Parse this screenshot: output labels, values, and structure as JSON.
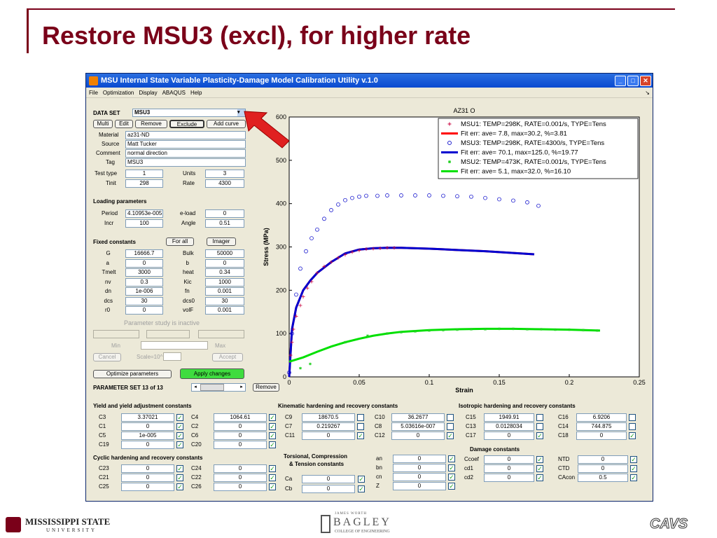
{
  "slide": {
    "title": "Restore MSU3 (excl), for higher rate",
    "logo_left": "MISSISSIPPI STATE",
    "logo_left_sub": "UNIVERSITY",
    "logo_center": "BAGLEY",
    "logo_center_top": "JAMES WORTH",
    "logo_center_sub": "COLLEGE OF ENGINEERING",
    "logo_right": "CAVS"
  },
  "window": {
    "title": "MSU Internal State Variable Plasticity-Damage Model Calibration Utility v.1.0",
    "menus": [
      "File",
      "Optimization",
      "Display",
      "ABAQUS",
      "Help"
    ],
    "menu_end": "↘"
  },
  "dataset": {
    "label": "DATA SET",
    "value": "MSU3",
    "buttons": [
      "Multi",
      "Edit",
      "Remove",
      "Exclude",
      "Add curve"
    ],
    "material_label": "Material",
    "material": "az31-ND",
    "source_label": "Source",
    "source": "Matt Tucker",
    "comment_label": "Comment",
    "comment": "normal direction",
    "tag_label": "Tag",
    "tag": "MSU3",
    "testtype_label": "Test type",
    "testtype": "1",
    "units_label": "Units",
    "units": "3",
    "tinit_label": "Tinit",
    "tinit": "298",
    "rate_label": "Rate",
    "rate": "4300"
  },
  "loading": {
    "heading": "Loading parameters",
    "period_label": "Period",
    "period": "4.10953e-005",
    "eload_label": "e-load",
    "eload": "0",
    "incr_label": "Incr",
    "incr": "100",
    "angle_label": "Angle",
    "angle": "0.51"
  },
  "fixed": {
    "heading": "Fixed constants",
    "forall": "For all",
    "imager": "Imager",
    "rows": [
      [
        "G",
        "16666.7",
        "Bulk",
        "50000"
      ],
      [
        "a",
        "0",
        "b",
        "0"
      ],
      [
        "Tmelt",
        "3000",
        "heat",
        "0.34"
      ],
      [
        "nv",
        "0.3",
        "Kic",
        "1000"
      ],
      [
        "dn",
        "1e-006",
        "fn",
        "0.001"
      ],
      [
        "dcs",
        "30",
        "dcs0",
        "30"
      ],
      [
        "r0",
        "0",
        "volF",
        "0.001"
      ]
    ]
  },
  "study": {
    "inactive": "Parameter study is inactive",
    "min": "Min",
    "max": "Max",
    "cancel": "Cancel",
    "scale": "Scale=10^",
    "accept": "Accept"
  },
  "actions": {
    "optimize": "Optimize parameters",
    "apply": "Apply changes",
    "paramset": "PARAMETER SET 13 of 13",
    "remove": "Remove"
  },
  "yield": {
    "heading": "Yield and yield adjustment constants",
    "rows": [
      [
        "C3",
        "3.37021",
        true,
        "C4",
        "1064.61",
        true
      ],
      [
        "C1",
        "0",
        true,
        "C2",
        "0",
        true
      ],
      [
        "C5",
        "1e-005",
        true,
        "C6",
        "0",
        true
      ],
      [
        "C19",
        "0",
        true,
        "C20",
        "0",
        true
      ]
    ]
  },
  "cyclic": {
    "heading": "Cyclic hardening and recovery constants",
    "rows": [
      [
        "C23",
        "0",
        true,
        "C24",
        "0",
        true
      ],
      [
        "C21",
        "0",
        true,
        "C22",
        "0",
        true
      ],
      [
        "C25",
        "0",
        true,
        "C26",
        "0",
        true
      ]
    ]
  },
  "kinematic": {
    "heading": "Kinematic hardening and recovery constants",
    "rows": [
      [
        "C9",
        "18670.5",
        false,
        "C10",
        "36.2677",
        false
      ],
      [
        "C7",
        "0.219267",
        false,
        "C8",
        "5.03616e-007",
        false
      ],
      [
        "C11",
        "0",
        true,
        "C12",
        "0",
        true
      ]
    ]
  },
  "torsional": {
    "heading1": "Torsional, Compression",
    "heading2": "& Tension constants",
    "ca_label": "Ca",
    "ca": "0",
    "cb_label": "Cb",
    "cb": "0",
    "rows": [
      [
        "an",
        "0",
        true
      ],
      [
        "bn",
        "0",
        true
      ],
      [
        "cn",
        "0",
        true
      ],
      [
        "Z",
        "0",
        true
      ]
    ]
  },
  "isotropic": {
    "heading": "Isotropic hardening and recovery constants",
    "rows": [
      [
        "C15",
        "1949.91",
        false,
        "C16",
        "6.9206",
        false
      ],
      [
        "C13",
        "0.0128034",
        false,
        "C14",
        "744.875",
        false
      ],
      [
        "C17",
        "0",
        true,
        "C18",
        "0",
        true
      ]
    ]
  },
  "damage": {
    "heading": "Damage constants",
    "rows": [
      [
        "Ccoef",
        "0",
        true,
        "NTD",
        "0",
        true
      ],
      [
        "cd1",
        "0",
        true,
        "CTD",
        "0",
        true
      ],
      [
        "cd2",
        "0",
        true,
        "CAcon",
        "0.5",
        true
      ]
    ]
  },
  "colors": {
    "msu1": "#c8003c",
    "msu3": "#2020d0",
    "msu2": "#20d020",
    "fit1": "#ff0000",
    "fit3": "#0000d0",
    "fit2": "#00e000",
    "arrow": "#e02020"
  },
  "chart_data": {
    "type": "line",
    "title": "AZ31 O",
    "xlabel": "Strain",
    "ylabel": "Stress (MPa)",
    "xlim": [
      0,
      0.25
    ],
    "ylim": [
      0,
      600
    ],
    "xticks": [
      "0",
      "0.05",
      "0.1",
      "0.15",
      "0.2",
      "0.25"
    ],
    "yticks": [
      "0",
      "100",
      "200",
      "300",
      "400",
      "500",
      "600"
    ],
    "legend": [
      "MSU1: TEMP=298K, RATE=0.001/s, TYPE=Tens",
      "Fit err: ave= 7.8, max=30.2, %=3.81",
      "MSU3: TEMP=298K, RATE=4300/s, TYPE=Tens",
      "Fit err: ave= 70.1, max=125.0, %=19.77",
      "MSU2: TEMP=473K, RATE=0.001/s, TYPE=Tens",
      "Fit err: ave= 5.1, max=32.0, %=16.10"
    ],
    "series": [
      {
        "name": "MSU1",
        "marker": "plus",
        "x": [
          0.001,
          0.002,
          0.003,
          0.005,
          0.008,
          0.01,
          0.013,
          0.016,
          0.02,
          0.025,
          0.03,
          0.035,
          0.04,
          0.045,
          0.05,
          0.055,
          0.06,
          0.065,
          0.07,
          0.075
        ],
        "y": [
          50,
          80,
          110,
          140,
          165,
          185,
          205,
          220,
          240,
          255,
          265,
          275,
          282,
          288,
          292,
          295,
          296,
          297,
          298,
          298
        ]
      },
      {
        "name": "MSU1 fit",
        "x": [
          0,
          0.002,
          0.005,
          0.01,
          0.015,
          0.02,
          0.03,
          0.04,
          0.05,
          0.06,
          0.07,
          0.08,
          0.1,
          0.12,
          0.14,
          0.16,
          0.175
        ],
        "y": [
          0,
          110,
          160,
          200,
          222,
          240,
          265,
          285,
          294,
          297,
          298,
          298,
          296,
          293,
          290,
          286,
          283
        ]
      },
      {
        "name": "MSU3",
        "marker": "circle",
        "x": [
          0,
          0.002,
          0.005,
          0.008,
          0.012,
          0.016,
          0.02,
          0.025,
          0.03,
          0.035,
          0.04,
          0.045,
          0.05,
          0.055,
          0.063,
          0.07,
          0.08,
          0.09,
          0.1,
          0.11,
          0.12,
          0.13,
          0.14,
          0.15,
          0.16,
          0.17,
          0.178
        ],
        "y": [
          10,
          100,
          190,
          250,
          290,
          320,
          340,
          365,
          385,
          398,
          408,
          413,
          416,
          418,
          418,
          419,
          419,
          419,
          419,
          418,
          417,
          416,
          413,
          410,
          407,
          403,
          395
        ]
      },
      {
        "name": "MSU3 fit",
        "x": [
          0,
          0.002,
          0.005,
          0.01,
          0.015,
          0.02,
          0.03,
          0.04,
          0.05,
          0.06,
          0.07,
          0.08,
          0.1,
          0.12,
          0.14,
          0.16,
          0.175
        ],
        "y": [
          0,
          110,
          160,
          200,
          222,
          240,
          265,
          285,
          294,
          297,
          298,
          298,
          296,
          293,
          290,
          286,
          283
        ]
      },
      {
        "name": "MSU2",
        "marker": "star",
        "x": [
          0.008,
          0.015,
          0.04,
          0.056,
          0.07,
          0.08,
          0.09,
          0.1,
          0.11,
          0.12,
          0.13,
          0.14,
          0.15,
          0.16,
          0.17,
          0.18,
          0.19,
          0.2,
          0.21,
          0.22
        ],
        "y": [
          20,
          30,
          80,
          95,
          100,
          103,
          105,
          107,
          108,
          109,
          110,
          110,
          111,
          111,
          110,
          110,
          109,
          109,
          108,
          107
        ]
      },
      {
        "name": "MSU2 fit",
        "x": [
          0,
          0.01,
          0.02,
          0.03,
          0.04,
          0.05,
          0.06,
          0.07,
          0.08,
          0.1,
          0.12,
          0.14,
          0.16,
          0.18,
          0.2,
          0.222
        ],
        "y": [
          35,
          45,
          58,
          70,
          80,
          88,
          95,
          100,
          104,
          108,
          110,
          111,
          111,
          110,
          109,
          107
        ]
      }
    ]
  }
}
